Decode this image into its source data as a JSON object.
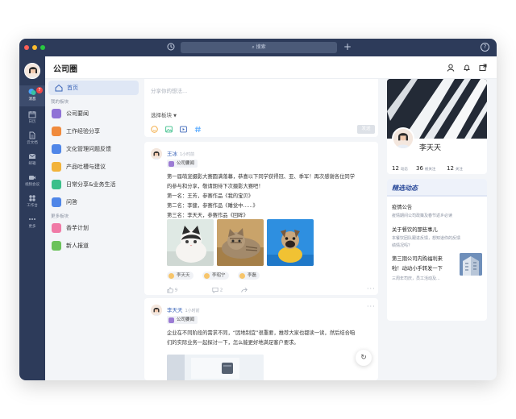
{
  "titlebar": {
    "search_placeholder": "搜索"
  },
  "rail": {
    "badge_count": "7",
    "items": [
      {
        "label": "消息",
        "icon": "chat-bubbles-icon"
      },
      {
        "label": "日历",
        "icon": "calendar-icon"
      },
      {
        "label": "云文档",
        "icon": "document-icon"
      },
      {
        "label": "邮箱",
        "icon": "mail-icon"
      },
      {
        "label": "视频会议",
        "icon": "video-camera-icon"
      },
      {
        "label": "工作台",
        "icon": "grid-icon"
      },
      {
        "label": "更多",
        "icon": "more-dots-icon"
      }
    ]
  },
  "header": {
    "title": "公司圈"
  },
  "sidebar": {
    "home_label": "首页",
    "my_section": "我的板块",
    "items": [
      {
        "label": "公司要闻",
        "color": "#8f72d6"
      },
      {
        "label": "工作经验分享",
        "color": "#f08a3c"
      },
      {
        "label": "文化管理问题反馈",
        "color": "#4f86e8"
      },
      {
        "label": "产品吐槽与建议",
        "color": "#f2b33a"
      },
      {
        "label": "日常分享&业务生活",
        "color": "#3bbf8a"
      },
      {
        "label": "问答",
        "color": "#4f86e8"
      }
    ],
    "more_section": "更多板块",
    "more_items": [
      {
        "label": "香芋计划",
        "color": "#f07aa6"
      },
      {
        "label": "新人报道",
        "color": "#6bc25a"
      }
    ]
  },
  "composer": {
    "placeholder": "分享你的想法...",
    "board_select": "选择板块",
    "send_label": "发送"
  },
  "posts": [
    {
      "author": "王冰",
      "time": "1小时前",
      "tag": "公司要闻",
      "lines": [
        "第一届萌宠摄影大赛圆满落幕，恭喜以下同学获得冠、亚、季军！再次感谢各位同学",
        "的参与和分享，敬请期待下次摄影大赛吧！",
        "第一名：王芳，参赛作品《我的宝贝》",
        "第二名：李健，参赛作品《睡觉中......》",
        "第三名：李天天，参赛作品《回眸》"
      ],
      "comments": [
        "李天天",
        "李昭宁",
        "李磊"
      ],
      "likes": "9",
      "replies": "2"
    },
    {
      "author": "李天天",
      "time": "1小时前",
      "tag": "公司要闻",
      "lines": [
        "企业在不同阶段的需求不同，“因地制宜”很重要，推荐大家也都读一读，然后结合咱",
        "们的实际业务一起探讨一下，怎么能更好地满足客户要求。"
      ]
    }
  ],
  "profile": {
    "name": "李天天",
    "stats": [
      {
        "num": "12",
        "label": "动态"
      },
      {
        "num": "36",
        "label": "被关注"
      },
      {
        "num": "12",
        "label": "关注"
      }
    ]
  },
  "news": {
    "heading": "精选动态",
    "items": [
      {
        "title": "疫情公告",
        "sub": "疫情期间公司政策及春节返乡必读"
      },
      {
        "title": "关于餐饮的那些事儿",
        "sub": "本餐饮团队跟进反馈，想知道你的反馈",
        "sub2": "绩情况吗？"
      },
      {
        "title": "第三期公司内购福利来",
        "title2": "啦！动动小手转发一下",
        "sub": "三周年司庆，员工活动及..."
      }
    ]
  }
}
